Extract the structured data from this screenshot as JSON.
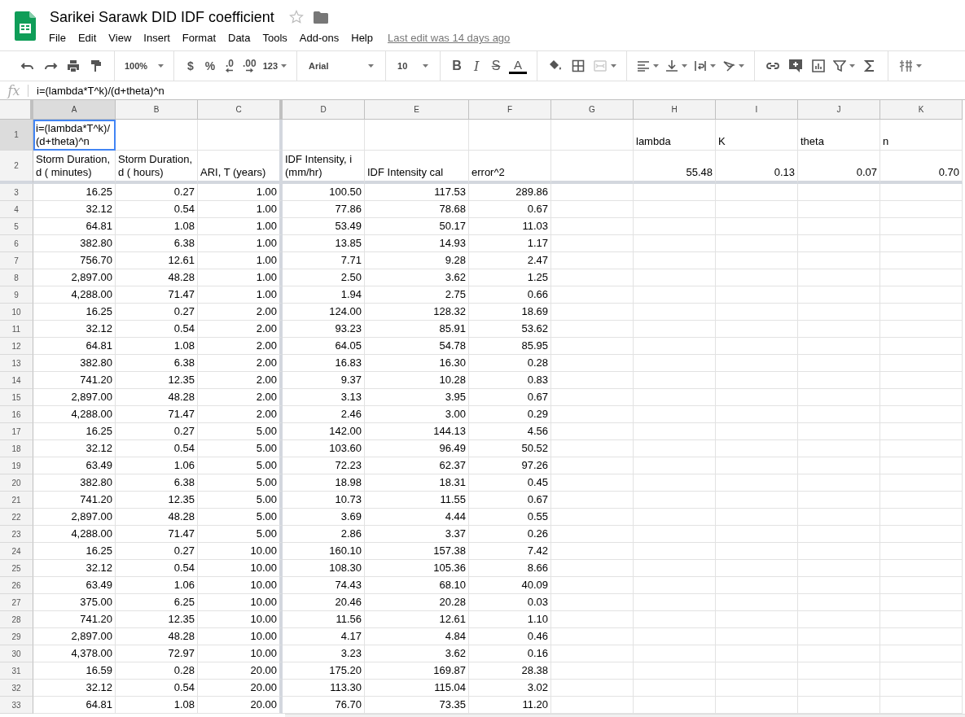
{
  "document": {
    "title": "Sarikei Sarawk DID IDF coefficient",
    "starred": false
  },
  "menu": [
    "File",
    "Edit",
    "View",
    "Insert",
    "Format",
    "Data",
    "Tools",
    "Add-ons",
    "Help"
  ],
  "last_edit": "Last edit was 14 days ago",
  "toolbar": {
    "zoom": "100%",
    "currency": "$",
    "percent": "%",
    "decrease_decimals": ".0",
    "increase_decimals": ".00",
    "more_formats": "123",
    "font": "Arial",
    "font_size": "10",
    "bold": "B",
    "italic": "I",
    "strikethrough": "S",
    "text_color": "A"
  },
  "formula_bar": {
    "label": "fx",
    "value": "i=(lambda*T^k)/(d+theta)^n"
  },
  "grid": {
    "columns": [
      {
        "label": "A",
        "selected": true
      },
      {
        "label": "B",
        "selected": false
      },
      {
        "label": "C",
        "selected": false
      },
      {
        "label": "D",
        "selected": false
      },
      {
        "label": "E",
        "selected": false
      },
      {
        "label": "F",
        "selected": false
      },
      {
        "label": "G",
        "selected": false
      },
      {
        "label": "H",
        "selected": false
      },
      {
        "label": "I",
        "selected": false
      },
      {
        "label": "J",
        "selected": false
      },
      {
        "label": "K",
        "selected": false
      }
    ],
    "rows": [
      {
        "number": "1",
        "selected": true,
        "cells": [
          {
            "text": "i=(lambda*T^k)/(d+theta)^n",
            "kind": "label"
          },
          null,
          null,
          null,
          null,
          null,
          null,
          {
            "text": "lambda",
            "kind": "label"
          },
          {
            "text": "K",
            "kind": "label"
          },
          {
            "text": "theta",
            "kind": "label"
          },
          {
            "text": "n",
            "kind": "label"
          }
        ]
      },
      {
        "number": "2",
        "selected": false,
        "cells": [
          {
            "text": "Storm Duration, d ( minutes)",
            "kind": "label"
          },
          {
            "text": "Storm Duration, d ( hours)",
            "kind": "label"
          },
          {
            "text": "ARI, T (years)",
            "kind": "label"
          },
          {
            "text": "IDF Intensity, i (mm/hr)",
            "kind": "label"
          },
          {
            "text": "IDF Intensity cal",
            "kind": "label"
          },
          {
            "text": "error^2",
            "kind": "label"
          },
          null,
          "55.48",
          "0.13",
          "0.07",
          "0.70"
        ]
      },
      {
        "number": "3",
        "selected": false,
        "cells": [
          "16.25",
          "0.27",
          "1.00",
          "100.50",
          "117.53",
          "289.86"
        ]
      },
      {
        "number": "4",
        "selected": false,
        "cells": [
          "32.12",
          "0.54",
          "1.00",
          "77.86",
          "78.68",
          "0.67"
        ]
      },
      {
        "number": "5",
        "selected": false,
        "cells": [
          "64.81",
          "1.08",
          "1.00",
          "53.49",
          "50.17",
          "11.03"
        ]
      },
      {
        "number": "6",
        "selected": false,
        "cells": [
          "382.80",
          "6.38",
          "1.00",
          "13.85",
          "14.93",
          "1.17"
        ]
      },
      {
        "number": "7",
        "selected": false,
        "cells": [
          "756.70",
          "12.61",
          "1.00",
          "7.71",
          "9.28",
          "2.47"
        ]
      },
      {
        "number": "8",
        "selected": false,
        "cells": [
          "2,897.00",
          "48.28",
          "1.00",
          "2.50",
          "3.62",
          "1.25"
        ]
      },
      {
        "number": "9",
        "selected": false,
        "cells": [
          "4,288.00",
          "71.47",
          "1.00",
          "1.94",
          "2.75",
          "0.66"
        ]
      },
      {
        "number": "10",
        "selected": false,
        "cells": [
          "16.25",
          "0.27",
          "2.00",
          "124.00",
          "128.32",
          "18.69"
        ]
      },
      {
        "number": "11",
        "selected": false,
        "cells": [
          "32.12",
          "0.54",
          "2.00",
          "93.23",
          "85.91",
          "53.62"
        ]
      },
      {
        "number": "12",
        "selected": false,
        "cells": [
          "64.81",
          "1.08",
          "2.00",
          "64.05",
          "54.78",
          "85.95"
        ]
      },
      {
        "number": "13",
        "selected": false,
        "cells": [
          "382.80",
          "6.38",
          "2.00",
          "16.83",
          "16.30",
          "0.28"
        ]
      },
      {
        "number": "14",
        "selected": false,
        "cells": [
          "741.20",
          "12.35",
          "2.00",
          "9.37",
          "10.28",
          "0.83"
        ]
      },
      {
        "number": "15",
        "selected": false,
        "cells": [
          "2,897.00",
          "48.28",
          "2.00",
          "3.13",
          "3.95",
          "0.67"
        ]
      },
      {
        "number": "16",
        "selected": false,
        "cells": [
          "4,288.00",
          "71.47",
          "2.00",
          "2.46",
          "3.00",
          "0.29"
        ]
      },
      {
        "number": "17",
        "selected": false,
        "cells": [
          "16.25",
          "0.27",
          "5.00",
          "142.00",
          "144.13",
          "4.56"
        ]
      },
      {
        "number": "18",
        "selected": false,
        "cells": [
          "32.12",
          "0.54",
          "5.00",
          "103.60",
          "96.49",
          "50.52"
        ]
      },
      {
        "number": "19",
        "selected": false,
        "cells": [
          "63.49",
          "1.06",
          "5.00",
          "72.23",
          "62.37",
          "97.26"
        ]
      },
      {
        "number": "20",
        "selected": false,
        "cells": [
          "382.80",
          "6.38",
          "5.00",
          "18.98",
          "18.31",
          "0.45"
        ]
      },
      {
        "number": "21",
        "selected": false,
        "cells": [
          "741.20",
          "12.35",
          "5.00",
          "10.73",
          "11.55",
          "0.67"
        ]
      },
      {
        "number": "22",
        "selected": false,
        "cells": [
          "2,897.00",
          "48.28",
          "5.00",
          "3.69",
          "4.44",
          "0.55"
        ]
      },
      {
        "number": "23",
        "selected": false,
        "cells": [
          "4,288.00",
          "71.47",
          "5.00",
          "2.86",
          "3.37",
          "0.26"
        ]
      },
      {
        "number": "24",
        "selected": false,
        "cells": [
          "16.25",
          "0.27",
          "10.00",
          "160.10",
          "157.38",
          "7.42"
        ]
      },
      {
        "number": "25",
        "selected": false,
        "cells": [
          "32.12",
          "0.54",
          "10.00",
          "108.30",
          "105.36",
          "8.66"
        ]
      },
      {
        "number": "26",
        "selected": false,
        "cells": [
          "63.49",
          "1.06",
          "10.00",
          "74.43",
          "68.10",
          "40.09"
        ]
      },
      {
        "number": "27",
        "selected": false,
        "cells": [
          "375.00",
          "6.25",
          "10.00",
          "20.46",
          "20.28",
          "0.03"
        ]
      },
      {
        "number": "28",
        "selected": false,
        "cells": [
          "741.20",
          "12.35",
          "10.00",
          "11.56",
          "12.61",
          "1.10"
        ]
      },
      {
        "number": "29",
        "selected": false,
        "cells": [
          "2,897.00",
          "48.28",
          "10.00",
          "4.17",
          "4.84",
          "0.46"
        ]
      },
      {
        "number": "30",
        "selected": false,
        "cells": [
          "4,378.00",
          "72.97",
          "10.00",
          "3.23",
          "3.62",
          "0.16"
        ]
      },
      {
        "number": "31",
        "selected": false,
        "cells": [
          "16.59",
          "0.28",
          "20.00",
          "175.20",
          "169.87",
          "28.38"
        ]
      },
      {
        "number": "32",
        "selected": false,
        "cells": [
          "32.12",
          "0.54",
          "20.00",
          "113.30",
          "115.04",
          "3.02"
        ]
      },
      {
        "number": "33",
        "selected": false,
        "cells": [
          "64.81",
          "1.08",
          "20.00",
          "76.70",
          "73.35",
          "11.20"
        ]
      }
    ]
  }
}
